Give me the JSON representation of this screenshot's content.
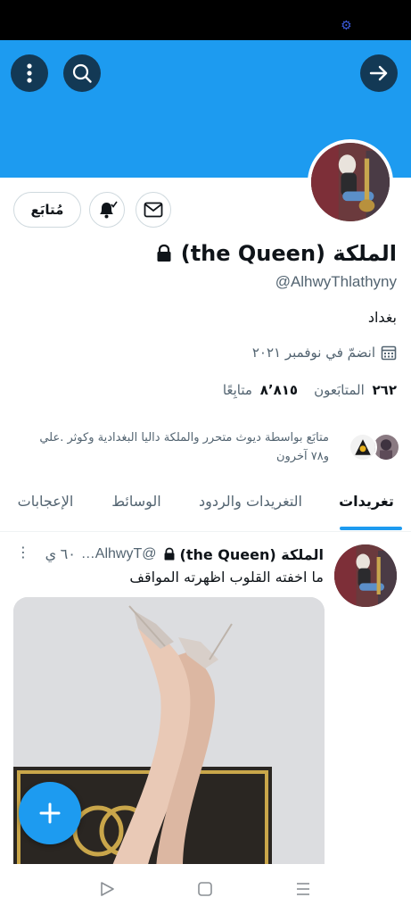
{
  "profile": {
    "name": "الملكة (the Queen)",
    "handle": "@AlhwyThlathyny",
    "bio": "بغداد",
    "joined": "انضمّ في نوفمبر ٢٠٢١",
    "followers_count": "٢٦٢",
    "followers_label": "المتابَعون",
    "following_count": "٨٬٨١٥",
    "following_label": "متابِعًا",
    "followed_by_line1": "متابَع بواسطة ديوث متحرر والملكة داليا البغدادية وكوثر .علي",
    "followed_by_line2": "و٧٨ آخرون",
    "follow_button": "مُتابَع"
  },
  "tabs": [
    {
      "label": "تغريدات",
      "active": true
    },
    {
      "label": "التغريدات والردود",
      "active": false
    },
    {
      "label": "الوسائط",
      "active": false
    },
    {
      "label": "الإعجابات",
      "active": false
    }
  ],
  "tweet": {
    "name": "الملكة (the Queen)",
    "handle": "@AlhwyT…",
    "time": "٦٠ ي",
    "text": "ما اخفته القلوب اظهرته المواقف"
  },
  "icons": {
    "settings": "gear-icon",
    "back": "arrow-right-icon",
    "search": "search-icon",
    "more": "more-vertical-icon",
    "message": "envelope-icon",
    "notify": "bell-check-icon",
    "lock": "lock-icon",
    "calendar": "calendar-icon",
    "compose": "plus-icon"
  },
  "colors": {
    "accent": "#1d9bf0",
    "text": "#0f1419",
    "muted": "#536471"
  }
}
